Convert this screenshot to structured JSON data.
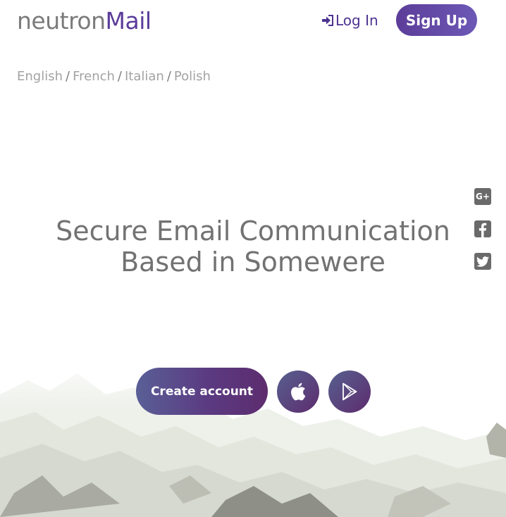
{
  "header": {
    "logo": {
      "part1": "neutron",
      "part2": "Mail"
    },
    "login_label": "Log In",
    "signup_label": "Sign Up"
  },
  "languages": [
    "English",
    "French",
    "Italian",
    "Polish"
  ],
  "language_separator": "/",
  "hero": {
    "line1": "Secure Email Communication",
    "line2": "Based in Somewere"
  },
  "actions": {
    "create_account_label": "Create account",
    "apple_icon": "apple-icon",
    "play_icon": "google-play-icon"
  },
  "social": [
    {
      "icon": "google-plus-icon",
      "glyph": "G+"
    },
    {
      "icon": "facebook-icon"
    },
    {
      "icon": "twitter-icon"
    }
  ],
  "colors": {
    "brand_purple": "#5b3c9a",
    "text_gray": "#727272",
    "language_gray": "#a3a3a3",
    "button_gradient_start": "#5a5f96",
    "button_gradient_end": "#5d2c6e"
  }
}
